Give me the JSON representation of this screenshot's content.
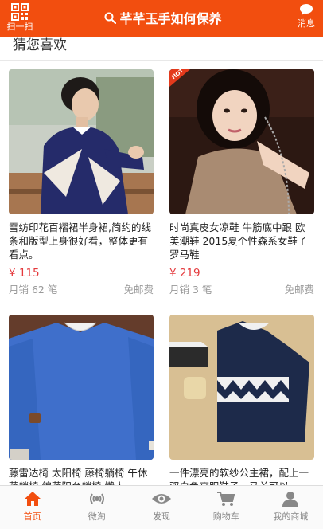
{
  "header": {
    "scan_label": "扫一扫",
    "search_keyword": "芊芊玉手如何保养",
    "message_label": "消息"
  },
  "section": {
    "title": "猜您喜欢"
  },
  "products": [
    {
      "title": "雪纺印花百褶裙半身裙,简约的线条和版型上身很好看，整体更有看点。",
      "price": "¥ 115",
      "sales": "月销 62 笔",
      "shipping": "免邮费"
    },
    {
      "badge": "HOT",
      "title": "时尚真皮女凉鞋 牛筋底中跟 欧美潮鞋 2015夏个性森系女鞋子罗马鞋",
      "price": "¥ 219",
      "sales": "月销 3 笔",
      "shipping": "免邮费"
    },
    {
      "title": "藤雷达椅 太阳椅 藤椅躺椅 午休藤躺椅 编藤阳台躺椅 懒人"
    },
    {
      "title": "一件漂亮的软纱公主裙，配上一双白色高跟鞋子，马关可以"
    }
  ],
  "tabbar": {
    "items": [
      {
        "label": "首页",
        "icon": "home-icon"
      },
      {
        "label": "微淘",
        "icon": "broadcast-icon"
      },
      {
        "label": "发现",
        "icon": "eye-icon"
      },
      {
        "label": "购物车",
        "icon": "cart-icon"
      },
      {
        "label": "我的商城",
        "icon": "user-icon"
      }
    ],
    "active_color": "#f24e0f"
  },
  "colors": {
    "brand": "#f24e0f",
    "price": "#e4393c"
  }
}
